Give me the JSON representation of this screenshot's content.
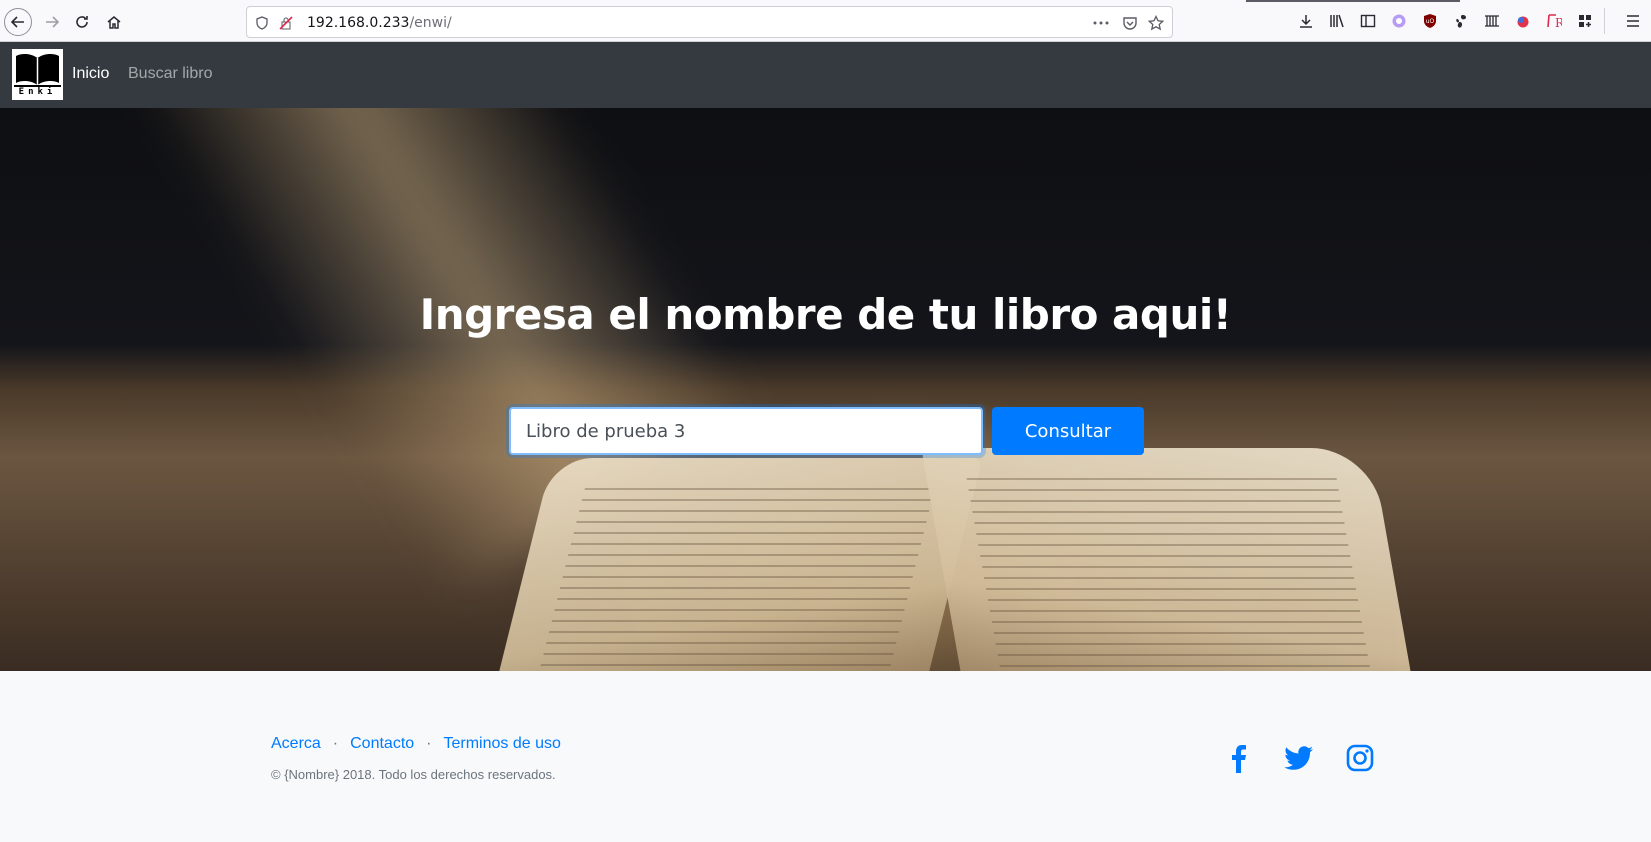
{
  "browser": {
    "url_host": "192.168.0.233",
    "url_path": "/enwi/",
    "icons": [
      "back-icon",
      "forward-icon",
      "reload-icon",
      "home-icon",
      "shield-icon",
      "insecure-lock-icon",
      "more-icon",
      "pocket-icon",
      "bookmark-star-icon",
      "download-icon",
      "library-icon",
      "sidebar-icon",
      "extension-icon",
      "ublock-icon",
      "gnome-icon",
      "abacus-icon",
      "container-icon",
      "rss-icon",
      "grid-icon",
      "menu-icon"
    ]
  },
  "navbar": {
    "logo_text": "Enki",
    "links": [
      {
        "label": "Inicio"
      },
      {
        "label": "Buscar libro"
      }
    ]
  },
  "hero": {
    "title": "Ingresa el nombre de tu libro aqui!",
    "search_value": "Libro de prueba 3",
    "button_label": "Consultar"
  },
  "footer": {
    "links": [
      {
        "label": "Acerca"
      },
      {
        "label": "Contacto"
      },
      {
        "label": "Terminos de uso"
      }
    ],
    "separator": "·",
    "copyright": "© {Nombre} 2018. Todo los derechos reservados.",
    "social_icons": [
      "facebook-icon",
      "twitter-icon",
      "instagram-icon"
    ],
    "link_color": "#007bff"
  },
  "colors": {
    "navbar_bg": "#343a40",
    "primary": "#007bff",
    "footer_bg": "#f8f9fa"
  }
}
